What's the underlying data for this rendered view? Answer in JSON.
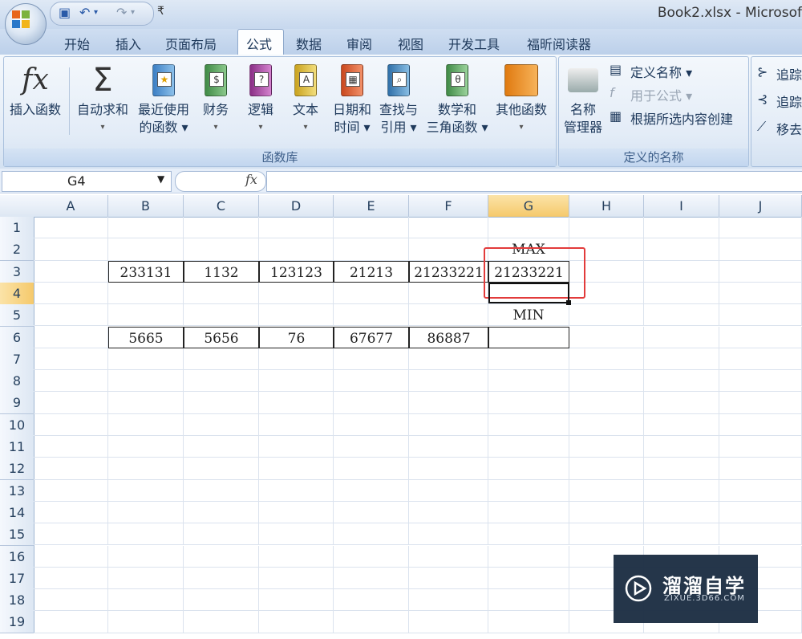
{
  "window": {
    "title": "Book2.xlsx - Microsof"
  },
  "qat": {
    "save_icon": "save-icon",
    "undo_icon": "undo-icon",
    "redo_icon": "redo-icon",
    "customize_icon": "customize-icon"
  },
  "tabs": [
    {
      "label": "开始"
    },
    {
      "label": "插入"
    },
    {
      "label": "页面布局"
    },
    {
      "label": "公式"
    },
    {
      "label": "数据"
    },
    {
      "label": "审阅"
    },
    {
      "label": "视图"
    },
    {
      "label": "开发工具"
    },
    {
      "label": "福昕阅读器"
    }
  ],
  "ribbon": {
    "function_library": {
      "label": "函数库",
      "buttons": [
        {
          "line1": "插入函数",
          "line2": ""
        },
        {
          "line1": "自动求和",
          "line2": "▾"
        },
        {
          "line1": "最近使用",
          "line2": "的函数 ▾"
        },
        {
          "line1": "财务",
          "line2": "▾"
        },
        {
          "line1": "逻辑",
          "line2": "▾"
        },
        {
          "line1": "文本",
          "line2": "▾"
        },
        {
          "line1": "日期和",
          "line2": "时间 ▾"
        },
        {
          "line1": "查找与",
          "line2": "引用 ▾"
        },
        {
          "line1": "数学和",
          "line2": "三角函数 ▾"
        },
        {
          "line1": "其他函数",
          "line2": "▾"
        }
      ]
    },
    "defined_names": {
      "label": "定义的名称",
      "name_manager": {
        "line1": "名称",
        "line2": "管理器"
      },
      "define_name": "定义名称 ▾",
      "use_in_formula": "用于公式 ▾",
      "create_from_selection": "根据所选内容创建"
    },
    "formula_auditing": {
      "trace_precedents": "追踪",
      "trace_dependents": "追踪",
      "remove_arrows": "移去"
    }
  },
  "formula_bar": {
    "name_box": "G4",
    "fx": "fx",
    "formula": ""
  },
  "columns": [
    "A",
    "B",
    "C",
    "D",
    "E",
    "F",
    "G",
    "H",
    "I",
    "J"
  ],
  "rows": [
    "1",
    "2",
    "3",
    "4",
    "5",
    "6",
    "7",
    "8",
    "9",
    "10",
    "11",
    "12",
    "13",
    "14",
    "15",
    "16",
    "17",
    "18",
    "19"
  ],
  "cells": {
    "G2": "MAX",
    "B3": "233131",
    "C3": "1132",
    "D3": "123123",
    "E3": "21213",
    "F3": "21233221",
    "G3": "21233221",
    "G5": "MIN",
    "B6": "5665",
    "C6": "5656",
    "D6": "76",
    "E6": "67677",
    "F6": "86887",
    "G6": ""
  },
  "watermark": {
    "name": "溜溜自学",
    "url": "ZIXUE.3D66.COM"
  },
  "colors": {
    "highlight": "#e23b3b",
    "selected_header": "#f5c96b"
  }
}
